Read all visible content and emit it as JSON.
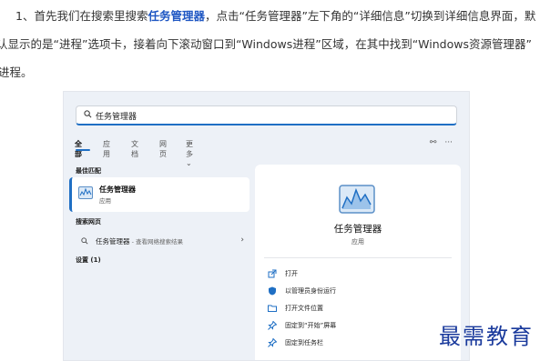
{
  "article": {
    "l1_a": "1、首先我们在搜索里搜索",
    "l1_b": "任务管理器",
    "l1_c": "，点击“任务管理器”左下角的“详细信息”切换到详细信息界面，默",
    "l2": "认显示的是“进程”选项卡，接着向下滚动窗口到“Windows进程”区域，在其中找到“Windows资源管理器”",
    "l3": "进程。"
  },
  "screenshot": {
    "search_value": "任务管理器",
    "tabs": [
      "全部",
      "应用",
      "文档",
      "网页",
      "更多"
    ],
    "more_chevron": "⌄",
    "right_icons": [
      "⚯",
      "···"
    ],
    "best_match_heading": "最佳匹配",
    "best_match": {
      "name": "任务管理器",
      "type": "应用"
    },
    "web_heading": "搜索网页",
    "web_item": {
      "text": "任务管理器",
      "sub": " - 查看网络搜索结果"
    },
    "settings_heading": "设置 (1)",
    "detail": {
      "title": "任务管理器",
      "subtitle": "应用"
    },
    "actions": [
      "打开",
      "以管理员身份运行",
      "打开文件位置",
      "固定到“开始”屏幕",
      "固定到任务栏"
    ]
  },
  "watermark": "最需教育",
  "colors": {
    "accent": "#1f6fc4",
    "highlight_text": "#1f57c3",
    "watermark": "#1a3a9c"
  }
}
